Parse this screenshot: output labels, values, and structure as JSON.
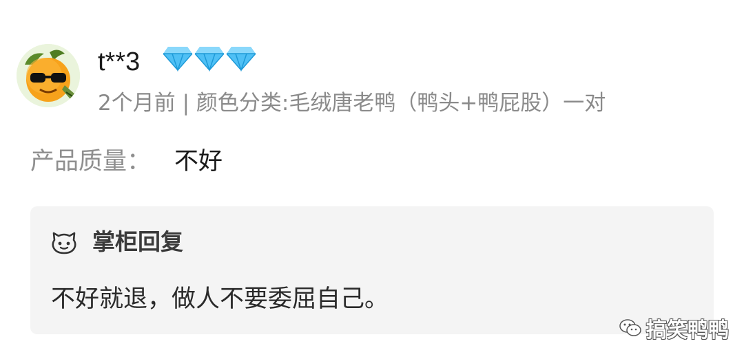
{
  "review": {
    "username": "t**3",
    "badge_icon": "diamond-icon",
    "badge_count": 3,
    "badge_color": "#3fb6f2",
    "meta": "2个月前 | 颜色分类:毛绒唐老鸭（鸭头+鸭屁股）一对",
    "quality_label": "产品质量：",
    "quality_value": "不好"
  },
  "reply": {
    "icon": "smile-face-icon",
    "title": "掌柜回复",
    "text": "不好就退，做人不要委屈自己。"
  },
  "watermark": {
    "icon": "wechat-icon",
    "text": "搞笑鸭鸭"
  }
}
